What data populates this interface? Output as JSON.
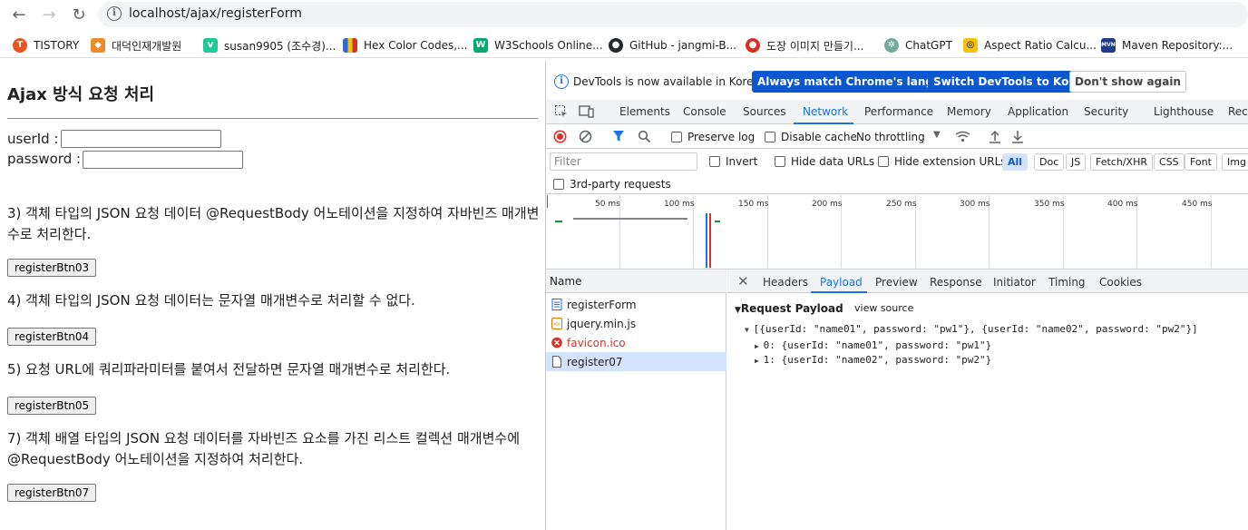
{
  "browser": {
    "url": "localhost/ajax/registerForm",
    "bookmarks": [
      {
        "label": "TISTORY",
        "icon": "tistory-icon",
        "color": "#eb531f"
      },
      {
        "label": "대덕인재개발원",
        "icon": "daedeok-icon",
        "color": "#f08c28"
      },
      {
        "label": "susan9905 (조수경)...",
        "icon": "velog-icon",
        "color": "#20c997"
      },
      {
        "label": "Hex Color Codes,...",
        "icon": "hex-color-icon",
        "color": "#3367d6"
      },
      {
        "label": "W3Schools Online...",
        "icon": "w3schools-icon",
        "color": "#04aa6d"
      },
      {
        "label": "GitHub - jangmi-B...",
        "icon": "github-icon",
        "color": "#24292f"
      },
      {
        "label": "도장 이미지 만들기...",
        "icon": "stamp-icon",
        "color": "#d93025"
      },
      {
        "label": "ChatGPT",
        "icon": "chatgpt-icon",
        "color": "#74aa9c"
      },
      {
        "label": "Aspect Ratio Calcu...",
        "icon": "aspect-ratio-icon",
        "color": "#f4c20d"
      },
      {
        "label": "Maven Repository:...",
        "icon": "maven-icon",
        "color": "#1e3a8a"
      }
    ]
  },
  "page": {
    "title": "Ajax 방식 요청 처리",
    "userid_label": "userId :",
    "password_label": "password :",
    "sections": [
      {
        "text": "3) 객체 타입의 JSON 요청 데이터 @RequestBody 어노테이션을 지정하여 자바빈즈 매개변수로 처리한다.",
        "button": "registerBtn03"
      },
      {
        "text": "4) 객체 타입의 JSON 요청 데이터는 문자열 매개변수로 처리할 수 없다.",
        "button": "registerBtn04"
      },
      {
        "text": "5) 요청 URL에 쿼리파라미터를 붙여서 전달하면 문자열 매개변수로 처리한다.",
        "button": "registerBtn05"
      },
      {
        "text": "7) 객체 배열 타입의 JSON 요청 데이터를 자바빈즈 요소를 가진 리스트 컬렉션 매개변수에 @RequestBody 어노테이션을 지정하여 처리한다.",
        "button": "registerBtn07"
      }
    ]
  },
  "devtools": {
    "notice": {
      "message": "DevTools is now available in Korean!",
      "match_btn": "Always match Chrome's language",
      "switch_btn": "Switch DevTools to Korean",
      "dismiss_btn": "Don't show again"
    },
    "tabs": [
      "Elements",
      "Console",
      "Sources",
      "Network",
      "Performance",
      "Memory",
      "Application",
      "Security",
      "Lighthouse",
      "Reco"
    ],
    "active_tab": "Network",
    "toolbar": {
      "preserve_log": "Preserve log",
      "disable_cache": "Disable cache",
      "throttling": "No throttling"
    },
    "filter": {
      "placeholder": "Filter",
      "invert": "Invert",
      "hide_data_urls": "Hide data URLs",
      "hide_extension_urls": "Hide extension URLs",
      "chips": [
        "All",
        "Doc",
        "JS",
        "Fetch/XHR",
        "CSS",
        "Font",
        "Img"
      ],
      "third_party": "3rd-party requests"
    },
    "timeline_ticks": [
      "50 ms",
      "100 ms",
      "150 ms",
      "200 ms",
      "250 ms",
      "300 ms",
      "350 ms",
      "400 ms",
      "450 ms"
    ],
    "name_header": "Name",
    "requests": [
      {
        "name": "registerForm",
        "icon": "document-icon",
        "color": "#202124"
      },
      {
        "name": "jquery.min.js",
        "icon": "script-icon",
        "color": "#202124"
      },
      {
        "name": "favicon.ico",
        "icon": "error-icon",
        "color": "#d93025"
      },
      {
        "name": "register07",
        "icon": "fetch-icon",
        "color": "#202124"
      }
    ],
    "detail_tabs": [
      "Headers",
      "Payload",
      "Preview",
      "Response",
      "Initiator",
      "Timing",
      "Cookies"
    ],
    "active_detail_tab": "Payload",
    "payload": {
      "section_title": "Request Payload",
      "view_source": "view source",
      "summary": "[{userId: \"name01\", password: \"pw1\"}, {userId: \"name02\", password: \"pw2\"}]",
      "items": [
        "0: {userId: \"name01\", password: \"pw1\"}",
        "1: {userId: \"name02\", password: \"pw2\"}"
      ]
    }
  }
}
